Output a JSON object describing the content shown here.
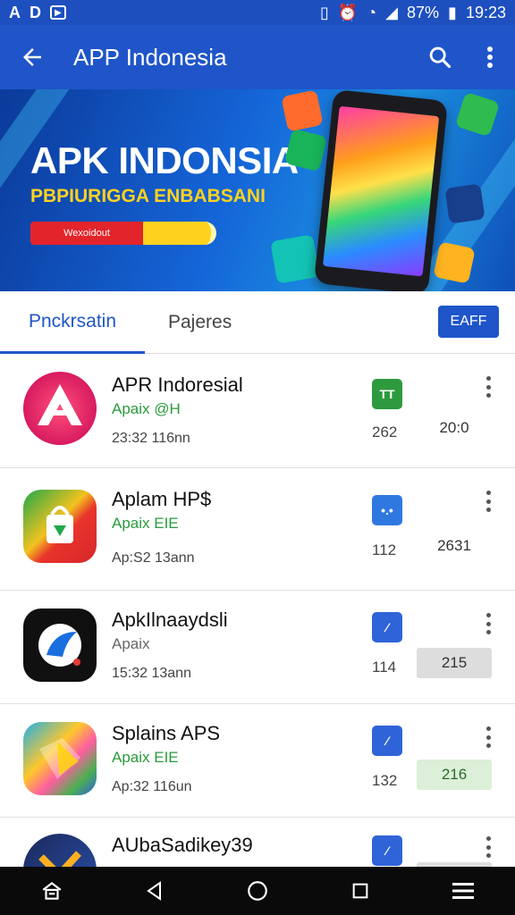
{
  "status_bar": {
    "left_icons": [
      "A",
      "D",
      "play-icon"
    ],
    "battery": "87%",
    "time": "19:23"
  },
  "app_bar": {
    "title": "APP Indonesia",
    "back_icon": "arrow-left-icon",
    "search_icon": "search-icon",
    "more_icon": "more-vert-icon"
  },
  "banner": {
    "title": "APK INDONSIA",
    "subtitle": "PBPIURIGGA ENBABSANI",
    "button_label": "Wexoidout"
  },
  "tabs": {
    "active_label": "Pnckrsatin",
    "inactive_label": "Pajeres",
    "button_label": "EAFF"
  },
  "apps": [
    {
      "name": "APR Indoresial",
      "sub": "Apaix @H",
      "meta": "23:32 116nn",
      "count": "262",
      "value": "20:0",
      "value_style": "plain",
      "badge_color": "#2e9a3e",
      "badge_glyph": "TT"
    },
    {
      "name": "Aplam HP$",
      "sub": "Apaix EIE",
      "meta": "Ap:S2 13ann",
      "count": "112",
      "value": "2631",
      "value_style": "plain",
      "badge_color": "#2f78e0",
      "badge_glyph": "•.•"
    },
    {
      "name": "ApkIlnaaydsli",
      "sub": "Apaix",
      "meta": "15:32 13ann",
      "count": "114",
      "value": "215",
      "value_style": "gray",
      "badge_color": "#2f63d8",
      "badge_glyph": "⁄"
    },
    {
      "name": "Splains APS",
      "sub": "Apaix EIE",
      "meta": "Ap:32 116un",
      "count": "132",
      "value": "216",
      "value_style": "green",
      "badge_color": "#2f63d8",
      "badge_glyph": "⁄"
    },
    {
      "name": "AUbaSadikey39",
      "sub": "",
      "meta": "",
      "count": "",
      "value": "",
      "value_style": "gray",
      "badge_color": "#2f63d8",
      "badge_glyph": "⁄"
    }
  ],
  "nav_bar": [
    "home-icon",
    "back-triangle-icon",
    "home-circle-icon",
    "recents-square-icon",
    "menu-icon"
  ]
}
